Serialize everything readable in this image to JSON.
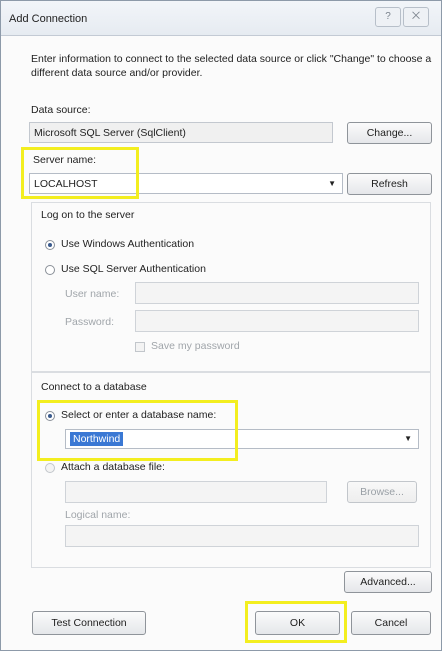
{
  "window": {
    "title": "Add Connection",
    "help_glyph": "?",
    "close_glyph": "⨉"
  },
  "intro_text": "Enter information to connect to the selected data source or click \"Change\" to choose a different data source and/or provider.",
  "data_source": {
    "label": "Data source:",
    "value": "Microsoft SQL Server (SqlClient)",
    "change_label": "Change..."
  },
  "server": {
    "label": "Server name:",
    "value": "LOCALHOST",
    "refresh_label": "Refresh"
  },
  "logon": {
    "title": "Log on to the server",
    "windows_auth_label": "Use Windows Authentication",
    "sql_auth_label": "Use SQL Server Authentication",
    "selected": "windows",
    "username_label": "User name:",
    "username_value": "",
    "password_label": "Password:",
    "password_value": "",
    "save_password_label": "Save my password"
  },
  "database": {
    "title": "Connect to a database",
    "select_label": "Select or enter a database name:",
    "select_value": "Northwind",
    "attach_label": "Attach a database file:",
    "attach_value": "",
    "browse_label": "Browse...",
    "logical_name_label": "Logical name:",
    "logical_name_value": "",
    "selected": "select"
  },
  "buttons": {
    "advanced": "Advanced...",
    "test_connection": "Test Connection",
    "ok": "OK",
    "cancel": "Cancel"
  },
  "highlight_color": "#f3ee1f",
  "icons": {
    "dropdown": "▼"
  }
}
